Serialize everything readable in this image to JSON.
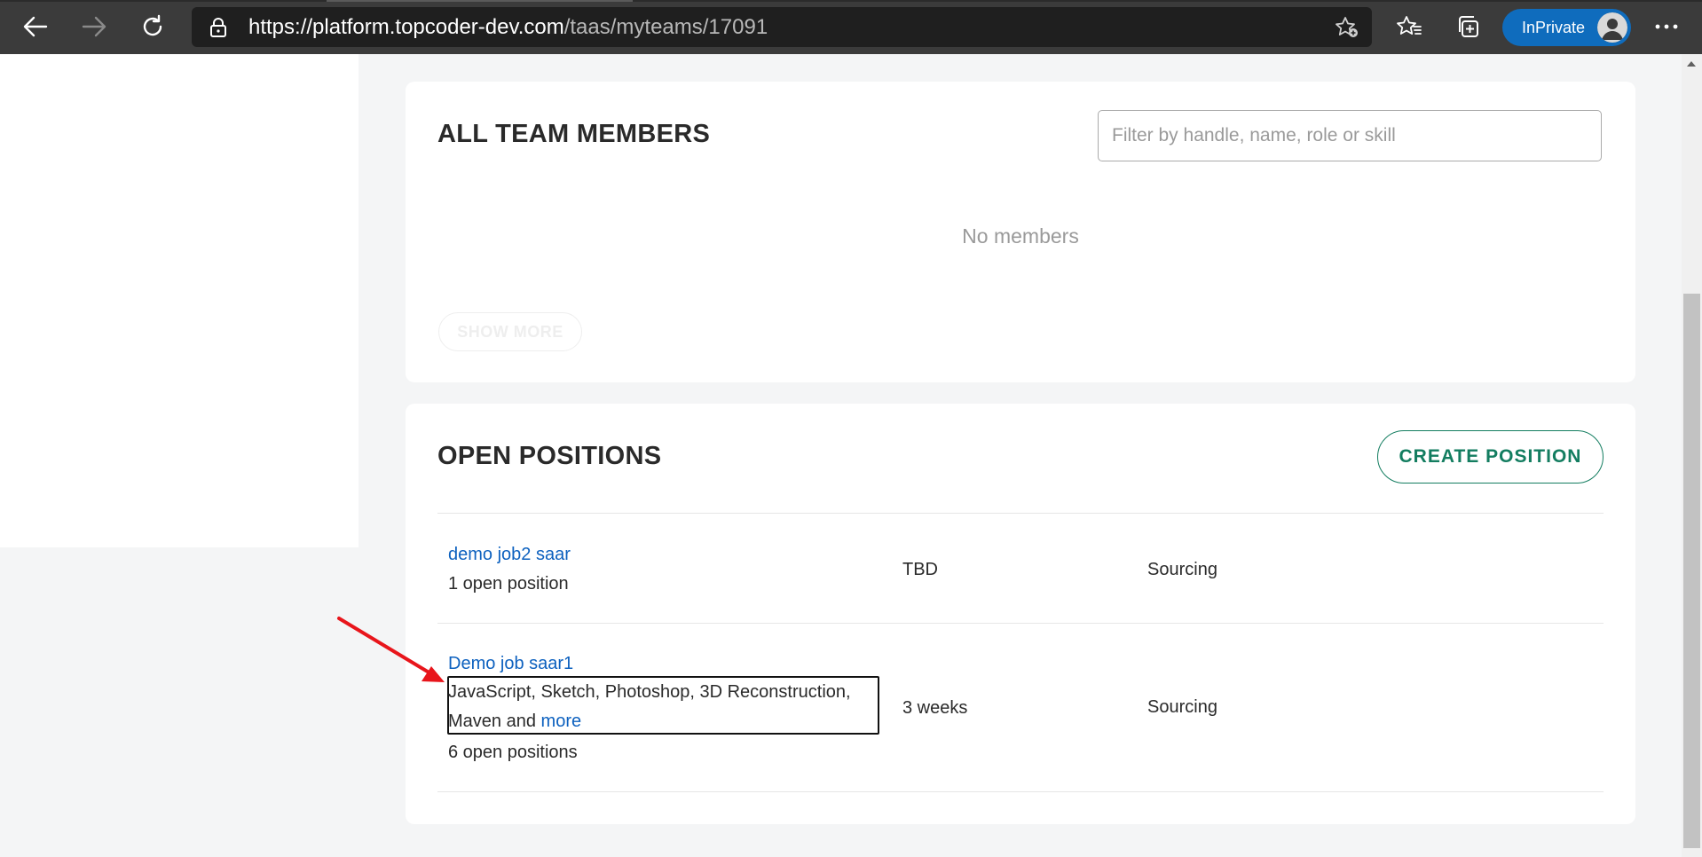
{
  "browser": {
    "url_host": "https://platform.topcoder-dev.com",
    "url_path": "/taas/myteams/17091",
    "inprivate_label": "InPrivate"
  },
  "members_card": {
    "title": "ALL TEAM MEMBERS",
    "filter_placeholder": "Filter by handle, name, role or skill",
    "empty_text": "No members",
    "show_more_label": "SHOW MORE"
  },
  "positions_card": {
    "title": "OPEN POSITIONS",
    "create_label": "CREATE POSITION",
    "rows": [
      {
        "title": "demo job2 saar",
        "subtitle": "1 open position",
        "duration": "TBD",
        "status": "Sourcing"
      },
      {
        "title": "Demo job saar1",
        "skills_prefix": "JavaScript, Sketch, Photoshop, 3D Reconstruction, Maven and",
        "skills_more": "more",
        "subtitle": "6 open positions",
        "duration": "3 weeks",
        "status": "Sourcing"
      }
    ]
  },
  "colors": {
    "accent_green": "#137d60",
    "link_blue": "#0d61bf",
    "inprivate_blue": "#0f6cbd",
    "annotation_red": "#e8151b"
  }
}
